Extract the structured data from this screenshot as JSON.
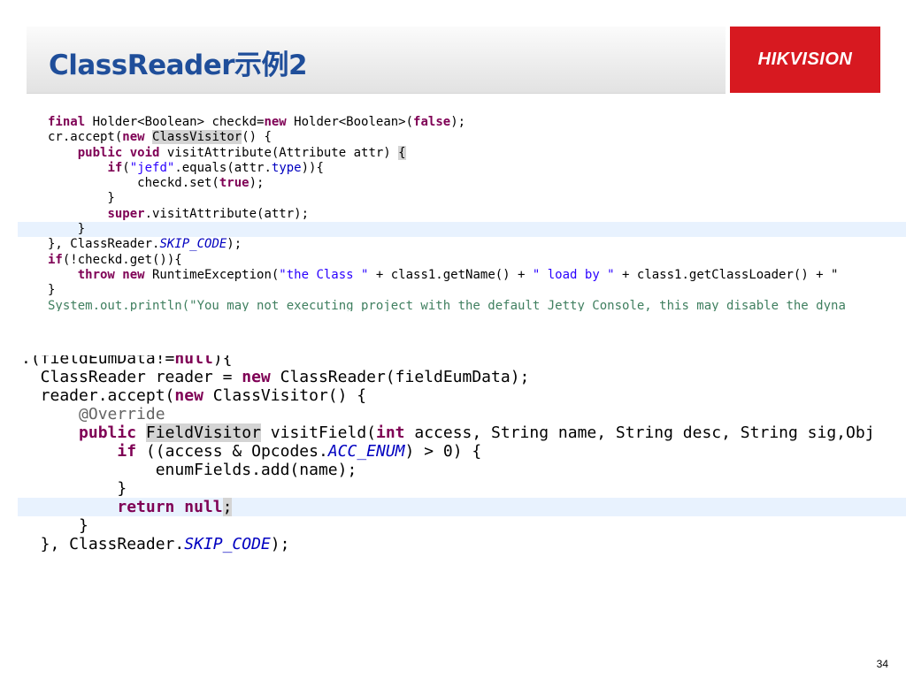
{
  "slide": {
    "title": "ClassReader示例2",
    "logo_text": "HIKVISION",
    "page_number": "34"
  },
  "colors": {
    "title": "#1f4e9a",
    "logo_background": "#d71920",
    "keyword": "#7f0055",
    "string": "#2a00ff",
    "static_field": "#0000c0",
    "highlight_line": "#e8f2fe"
  },
  "code_block_1": [
    {
      "highlight": false,
      "tokens": [
        {
          "t": "final",
          "c": "kw"
        },
        {
          "t": " Holder<Boolean> checkd="
        },
        {
          "t": "new",
          "c": "kw"
        },
        {
          "t": " Holder<Boolean>("
        },
        {
          "t": "false",
          "c": "kw"
        },
        {
          "t": ");"
        }
      ]
    },
    {
      "highlight": false,
      "tokens": [
        {
          "t": "cr.accept("
        },
        {
          "t": "new",
          "c": "kw"
        },
        {
          "t": " "
        },
        {
          "t": "ClassVisitor",
          "c": "sel"
        },
        {
          "t": "() {"
        }
      ]
    },
    {
      "highlight": false,
      "tokens": [
        {
          "t": "    "
        },
        {
          "t": "public void",
          "c": "kw"
        },
        {
          "t": " visitAttribute(Attribute attr) "
        },
        {
          "t": "{",
          "c": "sel"
        }
      ]
    },
    {
      "highlight": false,
      "tokens": [
        {
          "t": "        "
        },
        {
          "t": "if",
          "c": "kw"
        },
        {
          "t": "("
        },
        {
          "t": "\"jefd\"",
          "c": "str"
        },
        {
          "t": ".equals(attr."
        },
        {
          "t": "type",
          "c": "fld"
        },
        {
          "t": ")){"
        }
      ]
    },
    {
      "highlight": false,
      "tokens": [
        {
          "t": "            checkd.set("
        },
        {
          "t": "true",
          "c": "kw"
        },
        {
          "t": ");"
        }
      ]
    },
    {
      "highlight": false,
      "tokens": [
        {
          "t": "        }"
        }
      ]
    },
    {
      "highlight": false,
      "tokens": [
        {
          "t": "        "
        },
        {
          "t": "super",
          "c": "kw"
        },
        {
          "t": ".visitAttribute(attr);"
        }
      ]
    },
    {
      "highlight": true,
      "tokens": [
        {
          "t": "    }"
        }
      ]
    },
    {
      "highlight": false,
      "tokens": [
        {
          "t": "}, ClassReader."
        },
        {
          "t": "SKIP_CODE",
          "c": "st"
        },
        {
          "t": ");"
        }
      ]
    },
    {
      "highlight": false,
      "tokens": [
        {
          "t": "if",
          "c": "kw"
        },
        {
          "t": "(!checkd.get()){"
        }
      ]
    },
    {
      "highlight": false,
      "tokens": [
        {
          "t": "    "
        },
        {
          "t": "throw new",
          "c": "kw"
        },
        {
          "t": " RuntimeException("
        },
        {
          "t": "\"the Class \"",
          "c": "str"
        },
        {
          "t": " + class1.getName() + "
        },
        {
          "t": "\" load by \"",
          "c": "str"
        },
        {
          "t": " + class1.getClassLoader() + \""
        }
      ]
    },
    {
      "highlight": false,
      "tokens": [
        {
          "t": "}"
        }
      ]
    },
    {
      "highlight": false,
      "tokens": [
        {
          "t": "System.out.println(\"You may not executing project with the default Jetty Console, this may disable the dyna",
          "c": "cmt"
        }
      ]
    }
  ],
  "code_block_2": [
    {
      "highlight": false,
      "cut": true,
      "tokens": [
        {
          "t": ".(fieldEumData!="
        },
        {
          "t": "null",
          "c": "kw"
        },
        {
          "t": "){"
        }
      ]
    },
    {
      "highlight": false,
      "tokens": [
        {
          "t": "  ClassReader reader = "
        },
        {
          "t": "new",
          "c": "kw"
        },
        {
          "t": " ClassReader(fieldEumData);"
        }
      ]
    },
    {
      "highlight": false,
      "tokens": [
        {
          "t": "  reader.accept("
        },
        {
          "t": "new",
          "c": "kw"
        },
        {
          "t": " ClassVisitor() {"
        }
      ]
    },
    {
      "highlight": false,
      "tokens": [
        {
          "t": "      "
        },
        {
          "t": "@Override",
          "c": "ann"
        }
      ]
    },
    {
      "highlight": false,
      "tokens": [
        {
          "t": "      "
        },
        {
          "t": "public",
          "c": "kw"
        },
        {
          "t": " "
        },
        {
          "t": "FieldVisitor",
          "c": "sel"
        },
        {
          "t": " visitField("
        },
        {
          "t": "int",
          "c": "kw"
        },
        {
          "t": " access, String name, String desc, String sig,Obj"
        }
      ]
    },
    {
      "highlight": false,
      "tokens": [
        {
          "t": "          "
        },
        {
          "t": "if",
          "c": "kw"
        },
        {
          "t": " ((access & Opcodes."
        },
        {
          "t": "ACC_ENUM",
          "c": "st"
        },
        {
          "t": ") > 0) {"
        }
      ]
    },
    {
      "highlight": false,
      "tokens": [
        {
          "t": "              enumFields.add(name);"
        }
      ]
    },
    {
      "highlight": false,
      "tokens": [
        {
          "t": "          }"
        }
      ]
    },
    {
      "highlight": true,
      "tokens": [
        {
          "t": "          "
        },
        {
          "t": "return null",
          "c": "kw"
        },
        {
          "t": ";",
          "c": "sel"
        }
      ]
    },
    {
      "highlight": false,
      "tokens": [
        {
          "t": "      }"
        }
      ]
    },
    {
      "highlight": false,
      "tokens": [
        {
          "t": "  }, ClassReader."
        },
        {
          "t": "SKIP_CODE",
          "c": "st"
        },
        {
          "t": ");"
        }
      ]
    }
  ]
}
